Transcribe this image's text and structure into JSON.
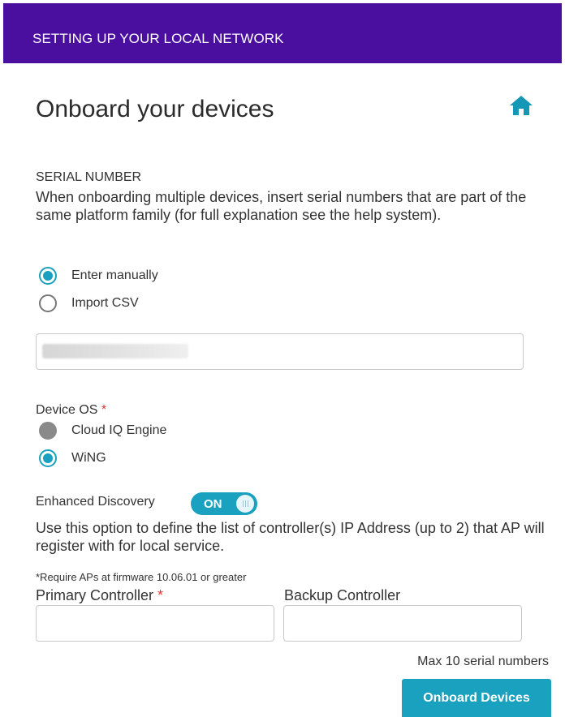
{
  "header": {
    "title": "SETTING UP YOUR LOCAL NETWORK",
    "bg_color": "#4b0fa0"
  },
  "page": {
    "title": "Onboard your devices",
    "home_icon": "home-icon"
  },
  "serial": {
    "label": "SERIAL NUMBER",
    "description": "When onboarding multiple devices, insert serial numbers that are part of the same platform family (for full explanation see the help system).",
    "options": [
      {
        "label": "Enter manually",
        "selected": true
      },
      {
        "label": "Import CSV",
        "selected": false
      }
    ],
    "input_value": ""
  },
  "device_os": {
    "label": "Device OS",
    "required_marker": "*",
    "options": [
      {
        "label": "Cloud IQ Engine",
        "selected": false,
        "disabled": true
      },
      {
        "label": "WiNG",
        "selected": true
      }
    ]
  },
  "enhanced_discovery": {
    "label": "Enhanced Discovery",
    "toggle_text": "ON",
    "enabled": true,
    "description": "Use this option to define the list of controller(s) IP Address (up to 2) that AP will register with for local service."
  },
  "controllers": {
    "firmware_note": "*Require APs at firmware 10.06.01 or greater",
    "primary_label": "Primary Controller",
    "primary_required": "*",
    "primary_value": "",
    "backup_label": "Backup Controller",
    "backup_value": ""
  },
  "footer": {
    "max_note": "Max 10 serial numbers",
    "submit_label": "Onboard Devices"
  },
  "colors": {
    "accent": "#1aa1bf",
    "required": "#e03535"
  }
}
